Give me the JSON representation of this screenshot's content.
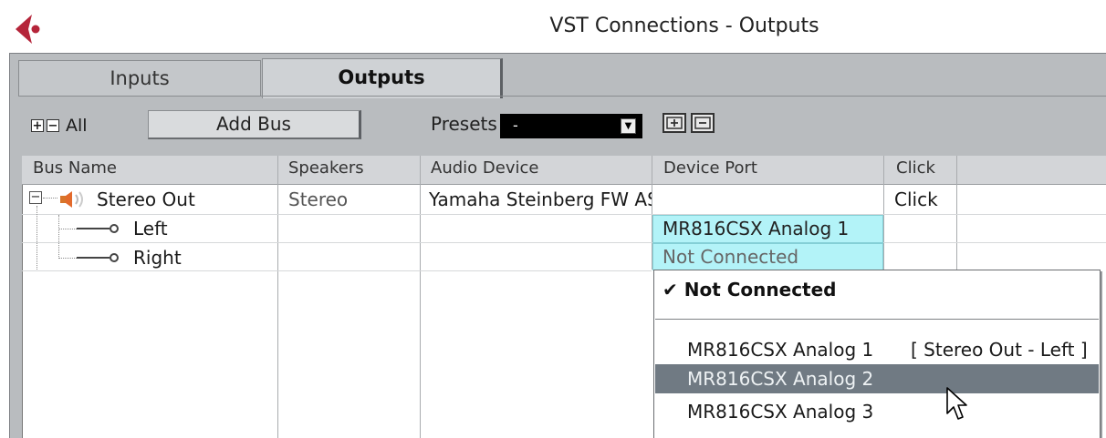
{
  "window": {
    "title": "VST Connections - Outputs"
  },
  "tabs": [
    {
      "label": "Inputs"
    },
    {
      "label": "Outputs"
    }
  ],
  "toolbar": {
    "expand_label": "+",
    "collapse_label": "−",
    "all_label": "All",
    "add_bus_label": "Add Bus",
    "presets_label": "Presets",
    "presets_value": "-",
    "store_preset_icon": "store-preset-icon",
    "remove_preset_icon": "remove-preset-icon"
  },
  "table": {
    "columns": [
      "Bus Name",
      "Speakers",
      "Audio Device",
      "Device Port",
      "Click"
    ],
    "rows": [
      {
        "bus_name": "Stereo Out",
        "speakers": "Stereo",
        "audio_device": "Yamaha Steinberg FW AS",
        "device_port": "",
        "click": "Click"
      },
      {
        "bus_name": "Left",
        "speakers": "",
        "audio_device": "",
        "device_port": "MR816CSX Analog 1",
        "click": ""
      },
      {
        "bus_name": "Right",
        "speakers": "",
        "audio_device": "",
        "device_port": "Not Connected",
        "click": ""
      }
    ]
  },
  "port_menu": {
    "checked_item": "Not Connected",
    "items": [
      {
        "label": "MR816CSX Analog 1",
        "assignment": "[ Stereo Out - Left ]"
      },
      {
        "label": "MR816CSX Analog 2",
        "assignment": ""
      },
      {
        "label": "MR816CSX Analog 3",
        "assignment": ""
      }
    ]
  },
  "colors": {
    "port_cell_highlight": "#b3f3f8",
    "menu_highlight": "#707a83",
    "logo": "#b5253a",
    "frame": "#b9bcbf"
  }
}
